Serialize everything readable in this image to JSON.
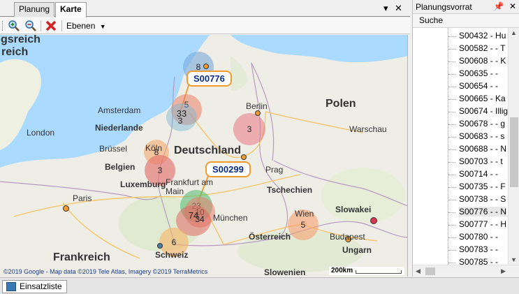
{
  "tabs": [
    {
      "label": "Planung"
    },
    {
      "label": "Karte"
    }
  ],
  "toolbar": {
    "layers_label": "Ebenen",
    "icons": [
      "zoom-in-icon",
      "zoom-out-icon",
      "delete-icon",
      "dropdown-arrow-icon"
    ]
  },
  "map": {
    "countries": [
      "Polen",
      "Deutschland",
      "Frankreich",
      "Tschechien",
      "Slowakei",
      "Schweiz",
      "Ungarn",
      "Österreich"
    ],
    "cities": [
      "Amsterdam",
      "Niederlande",
      "London",
      "Brüssel",
      "Belgien",
      "Köln",
      "Luxemburg",
      "Frankfurt am Main",
      "Berlin",
      "Warschau",
      "Prag",
      "Paris",
      "München",
      "Wien",
      "Budapest",
      "Slowenien",
      "gsreich"
    ],
    "callouts": [
      "S00776",
      "S00299"
    ],
    "clusters": [
      "8",
      "5",
      "33",
      "3",
      "3",
      "8",
      "3",
      "23",
      "10",
      "74",
      "34",
      "6",
      "5"
    ],
    "copyright": "©2019 Google - Map data ©2019 Tele Atlas, Imagery ©2019 TerraMetrics",
    "scale": "200km",
    "colors": {
      "accent": "#f29a2e",
      "callout_text": "#0a2d86"
    }
  },
  "right_panel": {
    "title": "Planungsvorrat",
    "search_label": "Suche",
    "items": [
      "S00432 - Hu",
      "S00582 -  - T",
      "S00608 -  - K",
      "S00635 -  - ",
      "S00654 -  - ",
      "S00665 - Ka",
      "S00674 - Illig",
      "S00678 -  - g",
      "S00683 -  - s",
      "S00688 -  - N",
      "S00703 -  - t",
      "S00714 -  - ",
      "S00735 -  - F",
      "S00738 -  - S",
      "S00776 -  - N",
      "S00777 -  - H",
      "S00780 -  - ",
      "S00783 -  - ",
      "S00785 -  - "
    ]
  },
  "bottom_tab": {
    "label": "Einsatzliste"
  }
}
